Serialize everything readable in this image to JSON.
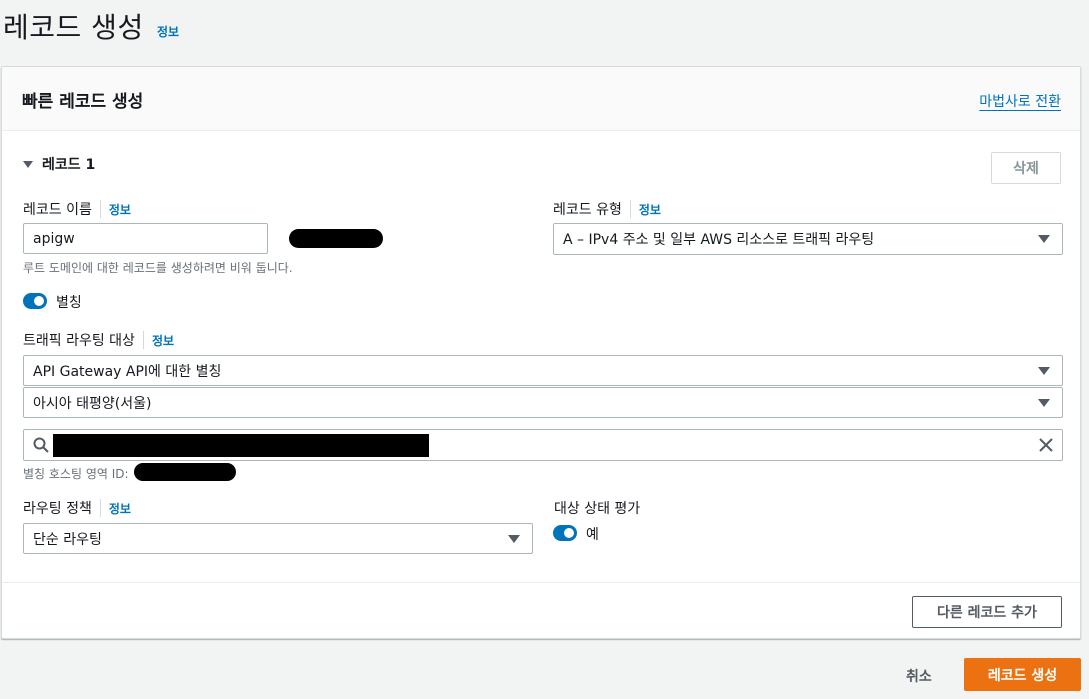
{
  "page": {
    "title": "레코드 생성",
    "info": "정보"
  },
  "panel": {
    "title": "빠른 레코드 생성",
    "wizard_link": "마법사로 전환"
  },
  "record": {
    "label": "레코드 1",
    "delete_label": "삭제",
    "name": {
      "label": "레코드 이름",
      "info": "정보",
      "value": "apigw",
      "help": "루트 도메인에 대한 레코드를 생성하려면 비워 둡니다."
    },
    "type": {
      "label": "레코드 유형",
      "info": "정보",
      "value": "A – IPv4 주소 및 일부 AWS 리소스로 트래픽 라우팅"
    },
    "alias": {
      "label": "별칭",
      "enabled": true
    },
    "target": {
      "label": "트래픽 라우팅 대상",
      "info": "정보",
      "endpoint": "API Gateway API에 대한 별칭",
      "region": "아시아 태평양(서울)",
      "search_value": "",
      "zone_label": "별칭 호스팅 영역 ID:"
    },
    "routing": {
      "label": "라우팅 정책",
      "info": "정보",
      "value": "단순 라우팅"
    },
    "health": {
      "label": "대상 상태 평가",
      "toggle_label": "예",
      "enabled": true
    }
  },
  "footer": {
    "add_label": "다른 레코드 추가",
    "cancel_label": "취소",
    "create_label": "레코드 생성"
  },
  "colors": {
    "primary": "#ec7211",
    "link": "#0073bb",
    "toggle": "#0073bb"
  }
}
